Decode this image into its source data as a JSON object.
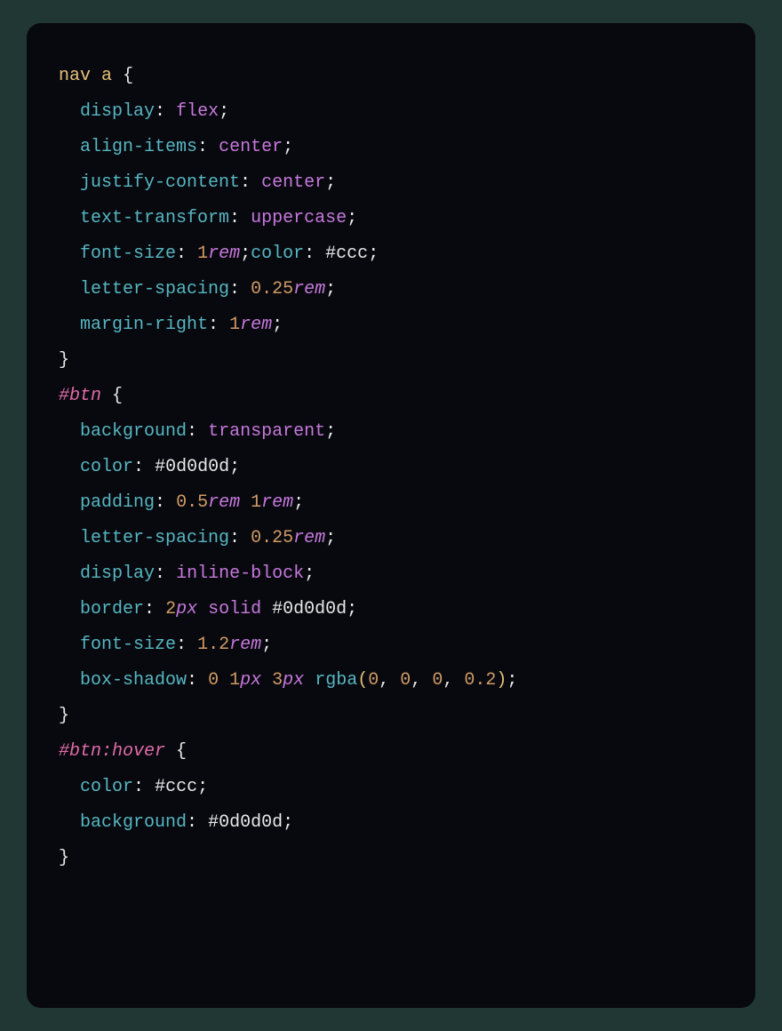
{
  "code": {
    "language": "css",
    "rules": [
      {
        "selector": "nav a",
        "declarations": [
          {
            "property": "display",
            "value": "flex"
          },
          {
            "property": "align-items",
            "value": "center"
          },
          {
            "property": "justify-content",
            "value": "center"
          },
          {
            "property": "text-transform",
            "value": "uppercase"
          },
          {
            "property": "font-size",
            "value": "1rem"
          },
          {
            "property": "color",
            "value": "#ccc",
            "same_line_as_previous": true
          },
          {
            "property": "letter-spacing",
            "value": "0.25rem"
          },
          {
            "property": "margin-right",
            "value": "1rem"
          }
        ]
      },
      {
        "selector": "#btn",
        "declarations": [
          {
            "property": "background",
            "value": "transparent"
          },
          {
            "property": "color",
            "value": "#0d0d0d"
          },
          {
            "property": "padding",
            "value": "0.5rem 1rem"
          },
          {
            "property": "letter-spacing",
            "value": "0.25rem"
          },
          {
            "property": "display",
            "value": "inline-block"
          },
          {
            "property": "border",
            "value": "2px solid #0d0d0d"
          },
          {
            "property": "font-size",
            "value": "1.2rem"
          },
          {
            "property": "box-shadow",
            "value": "0 1px 3px rgba(0, 0, 0, 0.2)"
          }
        ]
      },
      {
        "selector": "#btn:hover",
        "declarations": [
          {
            "property": "color",
            "value": "#ccc"
          },
          {
            "property": "background",
            "value": "#0d0d0d"
          }
        ]
      }
    ],
    "tokens": {
      "sel_nav": "nav",
      "sel_a": "a",
      "sel_btn": "#btn",
      "sel_hover": ":hover",
      "brace_open": "{",
      "brace_close": "}",
      "colon": ":",
      "semicolon": ";",
      "comma": ",",
      "space": " ",
      "p_display": "display",
      "v_flex": "flex",
      "p_align_items": "align-items",
      "v_center": "center",
      "p_justify_content": "justify-content",
      "p_text_transform": "text-transform",
      "v_uppercase": "uppercase",
      "p_font_size": "font-size",
      "n_1": "1",
      "u_rem": "rem",
      "p_color": "color",
      "h_ccc": "#ccc",
      "p_letter_spacing": "letter-spacing",
      "n_025": "0.25",
      "p_margin_right": "margin-right",
      "p_background": "background",
      "v_transparent": "transparent",
      "h_0d": "#0d0d0d",
      "p_padding": "padding",
      "n_05": "0.5",
      "v_inline_block": "inline-block",
      "p_border": "border",
      "n_2": "2",
      "u_px": "px",
      "v_solid": "solid",
      "n_1_2": "1.2",
      "p_box_shadow": "box-shadow",
      "n_0": "0",
      "n_3": "3",
      "fn_rgba": "rgba",
      "paren_open": "(",
      "paren_close": ")",
      "n_0_2": "0.2"
    }
  }
}
